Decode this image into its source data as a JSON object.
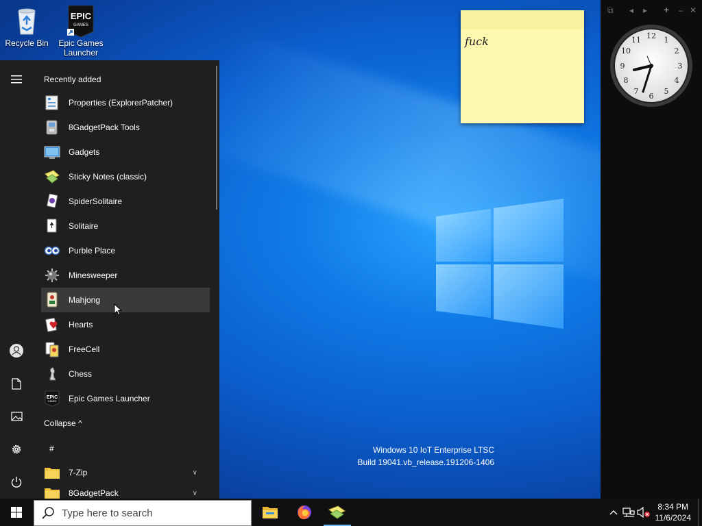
{
  "desktop": {
    "icons": [
      {
        "label": "Recycle Bin"
      },
      {
        "label": "Epic Games Launcher"
      }
    ],
    "sticky_note": {
      "text": "fuck"
    },
    "build_info": {
      "line1": "Windows 10 IoT Enterprise LTSC",
      "line2": "Build 19041.vb_release.191206-1406"
    }
  },
  "start_menu": {
    "recently_added_title": "Recently added",
    "recent_items": [
      {
        "label": "Properties (ExplorerPatcher)",
        "icon": "properties-icon"
      },
      {
        "label": "8GadgetPack Tools",
        "icon": "gadgetpack-tools-icon"
      },
      {
        "label": "Gadgets",
        "icon": "gadgets-icon"
      },
      {
        "label": "Sticky Notes (classic)",
        "icon": "sticky-notes-icon"
      },
      {
        "label": "SpiderSolitaire",
        "icon": "spider-solitaire-icon"
      },
      {
        "label": "Solitaire",
        "icon": "solitaire-icon"
      },
      {
        "label": "Purble Place",
        "icon": "purble-place-icon"
      },
      {
        "label": "Minesweeper",
        "icon": "minesweeper-icon"
      },
      {
        "label": "Mahjong",
        "icon": "mahjong-icon"
      },
      {
        "label": "Hearts",
        "icon": "hearts-icon"
      },
      {
        "label": "FreeCell",
        "icon": "freecell-icon"
      },
      {
        "label": "Chess",
        "icon": "chess-icon"
      },
      {
        "label": "Epic Games Launcher",
        "icon": "epic-games-icon"
      }
    ],
    "collapse_label": "Collapse ^",
    "hash_header": "#",
    "folders": [
      {
        "label": "7-Zip"
      },
      {
        "label": "8GadgetPack"
      }
    ]
  },
  "taskbar": {
    "search_placeholder": "Type here to search",
    "time": "8:34 PM",
    "date": "11/6/2024"
  },
  "colors": {
    "accent": "#76b9ed",
    "menu_bg": "#1f1f1f",
    "taskbar_bg": "#101010",
    "sticky": "#fdf9b0"
  }
}
